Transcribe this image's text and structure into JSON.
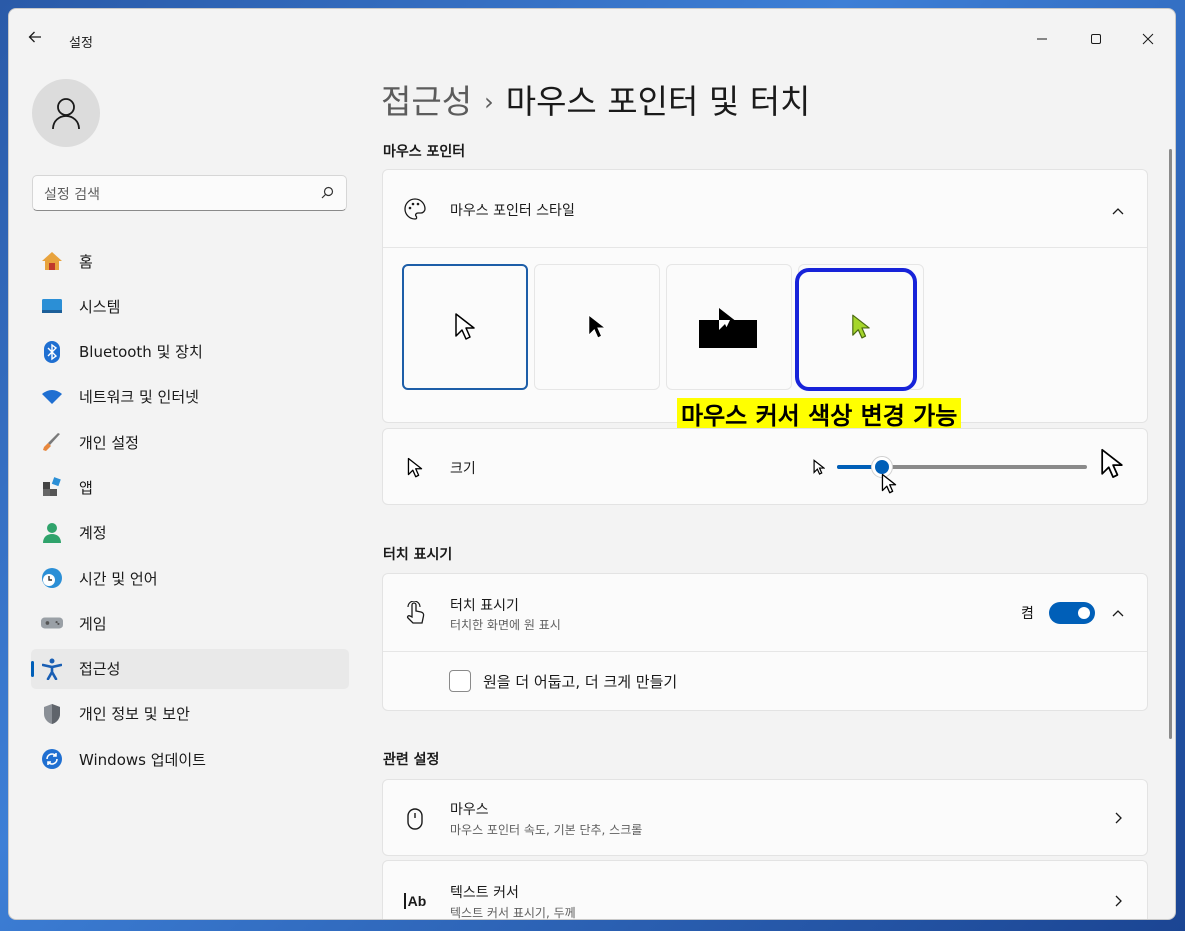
{
  "window": {
    "title": "설정"
  },
  "sidebar": {
    "search_placeholder": "설정 검색",
    "items": [
      {
        "label": "홈",
        "icon": "home-icon"
      },
      {
        "label": "시스템",
        "icon": "system-icon"
      },
      {
        "label": "Bluetooth 및 장치",
        "icon": "bluetooth-icon"
      },
      {
        "label": "네트워크 및 인터넷",
        "icon": "wifi-icon"
      },
      {
        "label": "개인 설정",
        "icon": "brush-icon"
      },
      {
        "label": "앱",
        "icon": "apps-icon"
      },
      {
        "label": "계정",
        "icon": "account-icon"
      },
      {
        "label": "시간 및 언어",
        "icon": "clock-globe-icon"
      },
      {
        "label": "게임",
        "icon": "gamepad-icon"
      },
      {
        "label": "접근성",
        "icon": "accessibility-icon",
        "active": true
      },
      {
        "label": "개인 정보 및 보안",
        "icon": "shield-icon"
      },
      {
        "label": "Windows 업데이트",
        "icon": "update-icon"
      }
    ]
  },
  "breadcrumb": {
    "parent": "접근성",
    "separator": "›",
    "current": "마우스 포인터 및 터치"
  },
  "sections": {
    "mouse_pointer": {
      "heading": "마우스 포인터",
      "style_row": {
        "title": "마우스 포인터 스타일"
      },
      "styles": [
        "white",
        "black",
        "inverted",
        "custom"
      ],
      "selected_style": "white",
      "custom_color": "#a5d62b",
      "annotation": "마우스 커서 색상 변경 가능",
      "size_row": {
        "title": "크기",
        "value_fraction": 0.18
      }
    },
    "touch": {
      "heading": "터치 표시기",
      "row": {
        "title": "터치 표시기",
        "subtitle": "터치한 화면에 원 표시",
        "state": "켬"
      },
      "checkbox": {
        "label": "원을 더 어둡고, 더 크게 만들기",
        "checked": false
      }
    },
    "related": {
      "heading": "관련 설정",
      "items": [
        {
          "title": "마우스",
          "subtitle": "마우스 포인터 속도, 기본 단추, 스크롤",
          "icon": "mouse-icon"
        },
        {
          "title": "텍스트 커서",
          "subtitle": "텍스트 커서 표시기, 두께",
          "icon": "text-cursor-icon",
          "icon_text": "Ab"
        }
      ]
    }
  },
  "colors": {
    "accent": "#005fb8",
    "annotation_bg": "#ffff00",
    "highlight_border": "#1723d9"
  }
}
